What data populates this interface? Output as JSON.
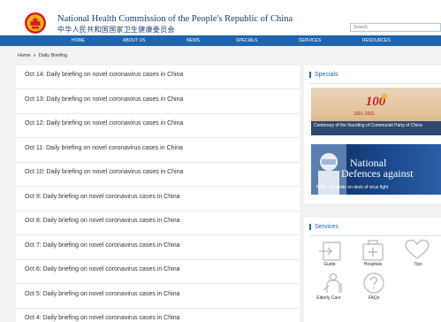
{
  "header": {
    "title_en": "National Health Commission of the People's Republic of China",
    "title_cn": "中华人民共和国国家卫生健康委员会",
    "search_placeholder": "Search"
  },
  "nav": {
    "items": [
      "HOME",
      "ABOUT US",
      "NEWS",
      "SPECIALS",
      "SERVICES",
      "RESOURCES"
    ]
  },
  "breadcrumb": {
    "home": "Home",
    "separator": "»",
    "current": "Daily Briefing"
  },
  "list": {
    "items": [
      "Oct 14: Daily briefing on novel coronavirus cases in China",
      "Oct 13: Daily briefing on novel coronavirus cases in China",
      "Oct 12: Daily briefing on novel coronavirus cases in China",
      "Oct 11: Daily briefing on novel coronavirus cases in China",
      "Oct 10: Daily briefing on novel coronavirus cases in China",
      "Oct 9: Daily briefing on novel coronavirus cases in China",
      "Oct 8: Daily briefing on novel coronavirus cases in China",
      "Oct 7: Daily briefing on novel coronavirus cases in China",
      "Oct 6: Daily briefing on novel coronavirus cases in China",
      "Oct 5: Daily briefing on novel coronavirus cases in China",
      "Oct 4: Daily briefing on novel coronavirus cases in China"
    ]
  },
  "specials": {
    "heading": "Specials",
    "banner1_years": "1921-2021",
    "banner1_caption": "Centenary of the founding of Communist Party of China",
    "banner2_title_line1": "National",
    "banner2_title_line2": "Defences against",
    "banner2_caption": "NHC: All hands on deck of virus fight"
  },
  "services": {
    "heading": "Services",
    "items": [
      {
        "label": "Guide",
        "icon": "guide-icon"
      },
      {
        "label": "Hospitals",
        "icon": "hospital-icon"
      },
      {
        "label": "Tips",
        "icon": "heart-icon"
      },
      {
        "label": "Elderly Care",
        "icon": "elderly-care-icon"
      },
      {
        "label": "FAQs",
        "icon": "question-icon"
      }
    ]
  },
  "colors": {
    "nav_blue": "#1f64ad",
    "title_navy": "#1a3c6e",
    "page_bg": "#f2f2f2",
    "icon_grey": "#b8b8b8"
  }
}
